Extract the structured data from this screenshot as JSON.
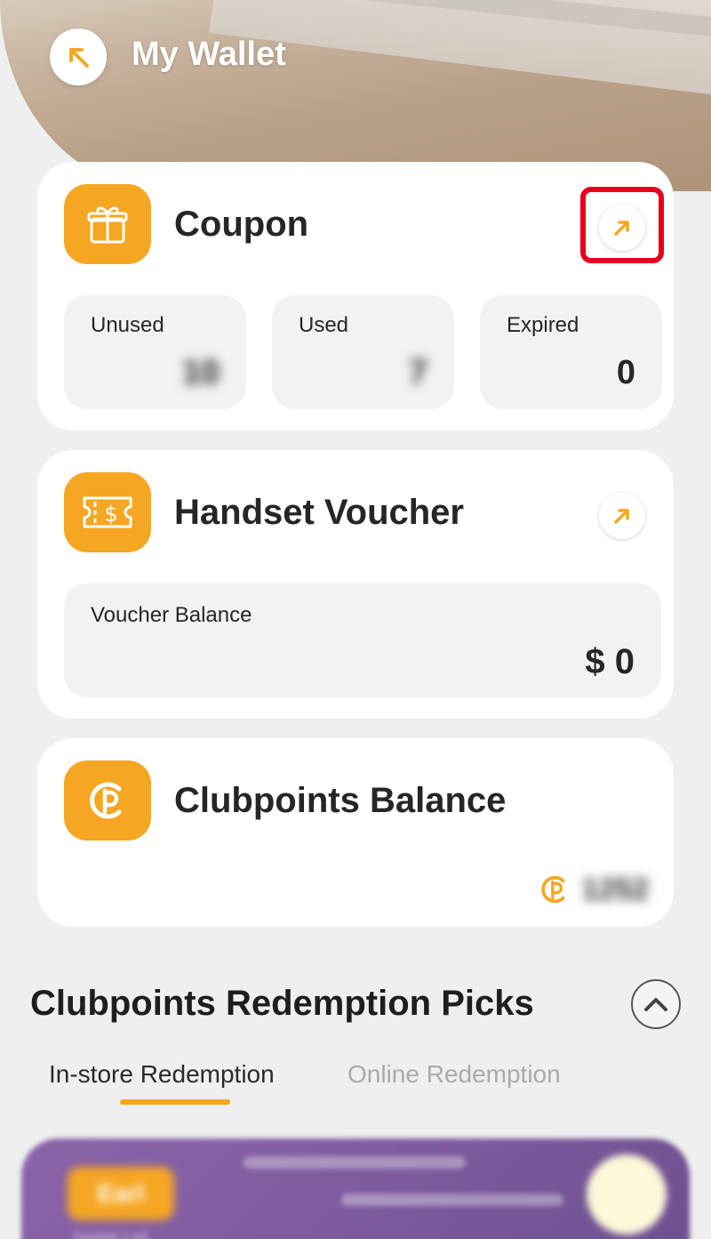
{
  "header": {
    "title": "My Wallet",
    "back_icon": "arrow-up-left-icon"
  },
  "coupon": {
    "title": "Coupon",
    "icon": "gift-icon",
    "stats": [
      {
        "label": "Unused",
        "value": "10"
      },
      {
        "label": "Used",
        "value": "7"
      },
      {
        "label": "Expired",
        "value": "0"
      }
    ]
  },
  "voucher": {
    "title": "Handset Voucher",
    "icon": "ticket-dollar-icon",
    "balance_label": "Voucher Balance",
    "balance_value": "$ 0"
  },
  "clubpoints": {
    "title": "Clubpoints Balance",
    "icon": "clubpoints-logo-icon",
    "value": "1252"
  },
  "redemption": {
    "title": "Clubpoints Redemption Picks",
    "tabs": [
      {
        "label": "In-store Redemption",
        "active": true
      },
      {
        "label": "Online Redemption",
        "active": false
      }
    ],
    "promo": {
      "tag": "Earl",
      "subtitle": "Jasbit Ltd"
    }
  },
  "colors": {
    "accent": "#f5a623",
    "highlight": "#e6001e",
    "background": "#efefef",
    "promo": "#7d5b9e"
  }
}
